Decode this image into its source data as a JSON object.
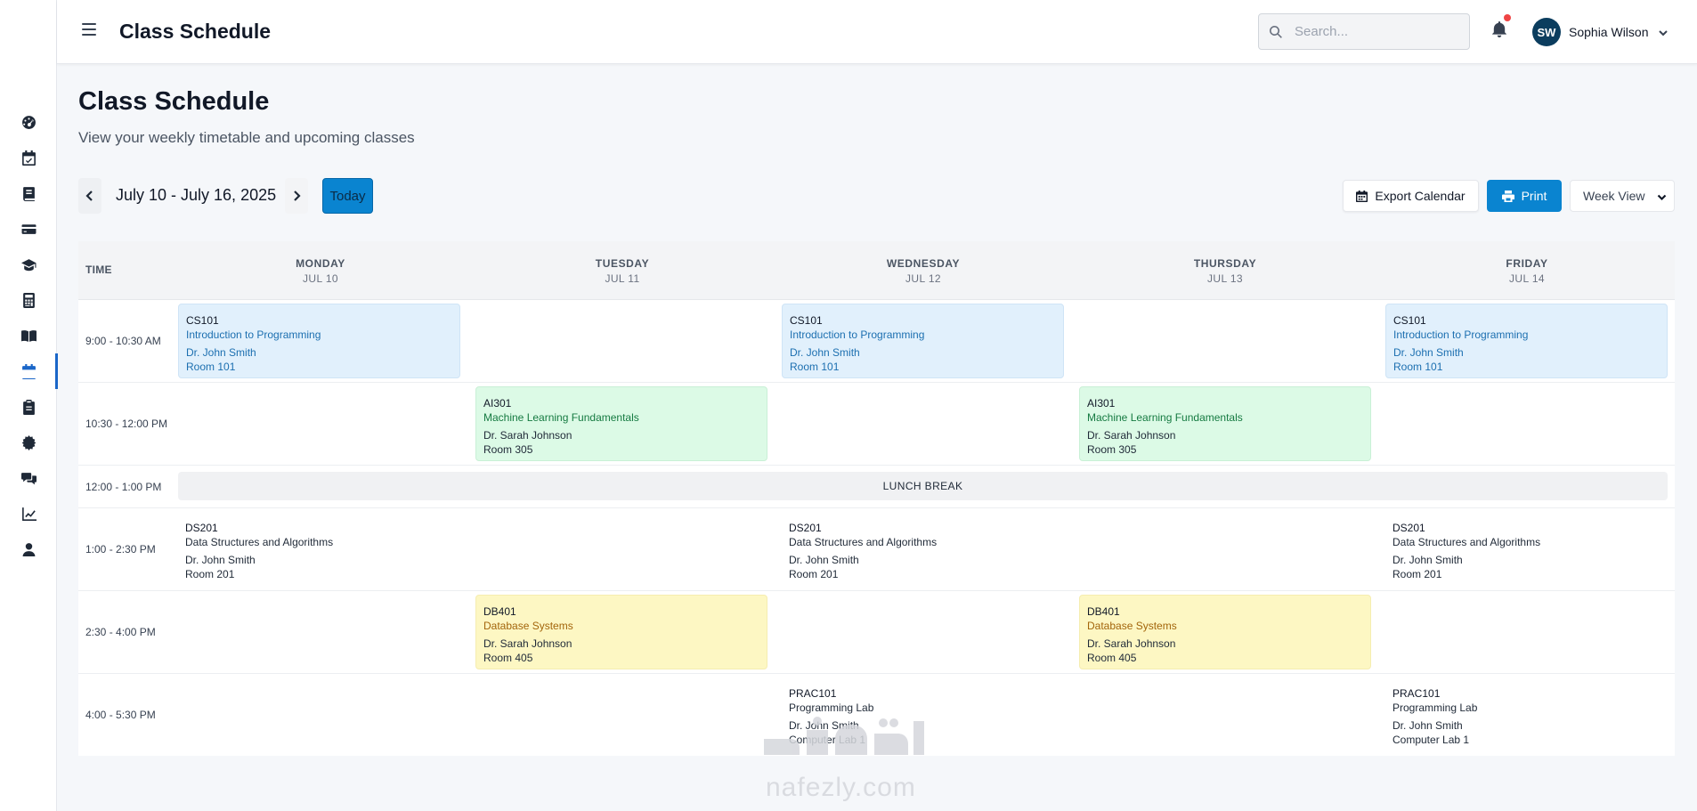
{
  "app": {
    "title": "Class Schedule"
  },
  "header": {
    "search_placeholder": "Search...",
    "user": {
      "initials": "SW",
      "name": "Sophia Wilson"
    }
  },
  "sidebar": {
    "items": [
      {
        "icon": "dashboard-icon"
      },
      {
        "icon": "calendar-check-icon"
      },
      {
        "icon": "book-icon"
      },
      {
        "icon": "credit-card-icon"
      },
      {
        "icon": "graduation-cap-icon"
      },
      {
        "icon": "calculator-icon"
      },
      {
        "icon": "open-book-icon"
      },
      {
        "icon": "calendar-icon",
        "active": true
      },
      {
        "icon": "clipboard-icon"
      },
      {
        "icon": "settings-icon"
      },
      {
        "icon": "chat-icon"
      },
      {
        "icon": "chart-icon"
      },
      {
        "icon": "user-icon"
      }
    ]
  },
  "page": {
    "title": "Class Schedule",
    "subtitle": "View your weekly timetable and upcoming classes"
  },
  "toolbar": {
    "date_range": "July 10 - July 16, 2025",
    "today_label": "Today",
    "export_label": "Export Calendar",
    "print_label": "Print",
    "view_label": "Week View"
  },
  "schedule": {
    "time_header": "TIME",
    "days": [
      {
        "name": "MONDAY",
        "date": "JUL 10"
      },
      {
        "name": "TUESDAY",
        "date": "JUL 11"
      },
      {
        "name": "WEDNESDAY",
        "date": "JUL 12"
      },
      {
        "name": "THURSDAY",
        "date": "JUL 13"
      },
      {
        "name": "FRIDAY",
        "date": "JUL 14"
      }
    ],
    "times": [
      "9:00 - 10:30 AM",
      "10:30 - 12:00 PM",
      "12:00 - 1:00 PM",
      "1:00 - 2:30 PM",
      "2:30 - 4:00 PM",
      "4:00 - 5:30 PM"
    ],
    "lunch_label": "LUNCH BREAK",
    "classes": {
      "cs101": {
        "code": "CS101",
        "title": "Introduction to Programming",
        "prof": "Dr. John Smith",
        "room": "Room 101"
      },
      "ai301": {
        "code": "AI301",
        "title": "Machine Learning Fundamentals",
        "prof": "Dr. Sarah Johnson",
        "room": "Room 305"
      },
      "ds201": {
        "code": "DS201",
        "title": "Data Structures and Algorithms",
        "prof": "Dr. John Smith",
        "room": "Room 201"
      },
      "db401": {
        "code": "DB401",
        "title": "Database Systems",
        "prof": "Dr. Sarah Johnson",
        "room": "Room 405"
      },
      "prac101": {
        "code": "PRAC101",
        "title": "Programming Lab",
        "prof": "Dr. John Smith",
        "room": "Computer Lab 1"
      }
    }
  },
  "watermark": {
    "text": "nafezly.com"
  },
  "colors": {
    "accent": "#0a84d0",
    "sidebar_active": "#1a66c8",
    "blue_block": "#e1f0fc",
    "green_block": "#dcfae6",
    "yellow_block": "#fdf7c3",
    "notification_dot": "#ef4444"
  }
}
